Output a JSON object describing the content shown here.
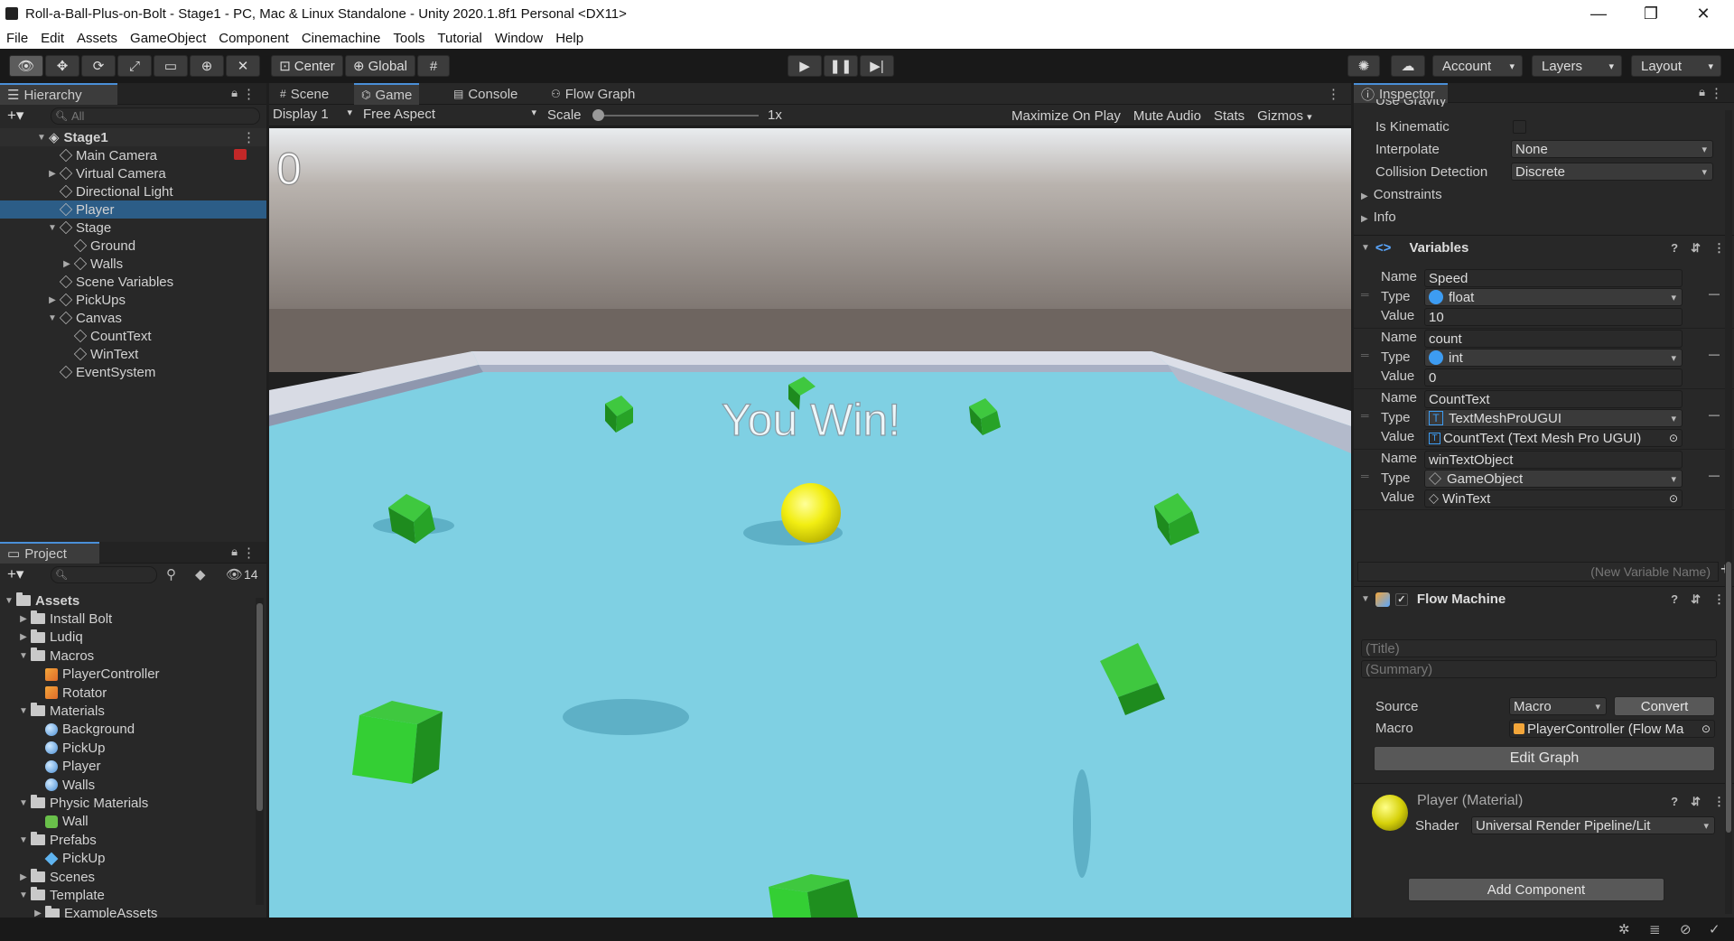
{
  "window": {
    "title": "Roll-a-Ball-Plus-on-Bolt - Stage1 - PC, Mac & Linux Standalone - Unity 2020.1.8f1 Personal <DX11>",
    "minimize": "—",
    "maximize": "❐",
    "close": "✕"
  },
  "menu": [
    "File",
    "Edit",
    "Assets",
    "GameObject",
    "Component",
    "Cinemachine",
    "Tools",
    "Tutorial",
    "Window",
    "Help"
  ],
  "toolbar": {
    "pivot_center": "Center",
    "pivot_global": "Global",
    "account": "Account",
    "layers": "Layers",
    "layout": "Layout"
  },
  "hierarchy": {
    "tab": "Hierarchy",
    "search_placeholder": "All",
    "scene": "Stage1",
    "items": [
      {
        "label": "Main Camera",
        "depth": 1,
        "arrow": ""
      },
      {
        "label": "Virtual Camera",
        "depth": 1,
        "arrow": "▶"
      },
      {
        "label": "Directional Light",
        "depth": 1,
        "arrow": ""
      },
      {
        "label": "Player",
        "depth": 1,
        "arrow": "",
        "selected": true
      },
      {
        "label": "Stage",
        "depth": 1,
        "arrow": "▼"
      },
      {
        "label": "Ground",
        "depth": 2,
        "arrow": ""
      },
      {
        "label": "Walls",
        "depth": 2,
        "arrow": "▶"
      },
      {
        "label": "Scene Variables",
        "depth": 1,
        "arrow": ""
      },
      {
        "label": "PickUps",
        "depth": 1,
        "arrow": "▶"
      },
      {
        "label": "Canvas",
        "depth": 1,
        "arrow": "▼"
      },
      {
        "label": "CountText",
        "depth": 2,
        "arrow": ""
      },
      {
        "label": "WinText",
        "depth": 2,
        "arrow": ""
      },
      {
        "label": "EventSystem",
        "depth": 1,
        "arrow": ""
      }
    ]
  },
  "project": {
    "tab": "Project",
    "hidden_count": "14",
    "items": [
      {
        "label": "Assets",
        "depth": 0,
        "arrow": "▼",
        "icon": "folder",
        "bold": true
      },
      {
        "label": "Install Bolt",
        "depth": 1,
        "arrow": "▶",
        "icon": "folder"
      },
      {
        "label": "Ludiq",
        "depth": 1,
        "arrow": "▶",
        "icon": "folder"
      },
      {
        "label": "Macros",
        "depth": 1,
        "arrow": "▼",
        "icon": "folder"
      },
      {
        "label": "PlayerController",
        "depth": 2,
        "arrow": "",
        "icon": "bolt"
      },
      {
        "label": "Rotator",
        "depth": 2,
        "arrow": "",
        "icon": "bolt"
      },
      {
        "label": "Materials",
        "depth": 1,
        "arrow": "▼",
        "icon": "folder"
      },
      {
        "label": "Background",
        "depth": 2,
        "arrow": "",
        "icon": "sphere"
      },
      {
        "label": "PickUp",
        "depth": 2,
        "arrow": "",
        "icon": "sphere"
      },
      {
        "label": "Player",
        "depth": 2,
        "arrow": "",
        "icon": "sphere"
      },
      {
        "label": "Walls",
        "depth": 2,
        "arrow": "",
        "icon": "sphere"
      },
      {
        "label": "Physic Materials",
        "depth": 1,
        "arrow": "▼",
        "icon": "folder"
      },
      {
        "label": "Wall",
        "depth": 2,
        "arrow": "",
        "icon": "phys"
      },
      {
        "label": "Prefabs",
        "depth": 1,
        "arrow": "▼",
        "icon": "folder"
      },
      {
        "label": "PickUp",
        "depth": 2,
        "arrow": "",
        "icon": "prefab"
      },
      {
        "label": "Scenes",
        "depth": 1,
        "arrow": "▶",
        "icon": "folder"
      },
      {
        "label": "Template",
        "depth": 1,
        "arrow": "▼",
        "icon": "folder"
      },
      {
        "label": "ExampleAssets",
        "depth": 2,
        "arrow": "▶",
        "icon": "folder"
      }
    ]
  },
  "center": {
    "tabs": [
      "Scene",
      "Game",
      "Console",
      "Flow Graph"
    ],
    "display": "Display 1",
    "aspect": "Free Aspect",
    "scale_label": "Scale",
    "scale_value": "1x",
    "maximize": "Maximize On Play",
    "mute": "Mute Audio",
    "stats": "Stats",
    "gizmos": "Gizmos"
  },
  "game": {
    "score": "0",
    "win_text": "You Win!"
  },
  "inspector": {
    "tab": "Inspector",
    "partial_top": "Use Gravity",
    "is_kinematic": "Is Kinematic",
    "interpolate": {
      "label": "Interpolate",
      "value": "None"
    },
    "collision": {
      "label": "Collision Detection",
      "value": "Discrete"
    },
    "constraints": "Constraints",
    "info": "Info",
    "variables_title": "Variables",
    "variables": [
      {
        "name": "Speed",
        "type": "float",
        "value": "10"
      },
      {
        "name": "count",
        "type": "int",
        "value": "0"
      },
      {
        "name": "CountText",
        "type": "TextMeshProUGUI",
        "value": "CountText (Text Mesh Pro UGUI)"
      },
      {
        "name": "winTextObject",
        "type": "GameObject",
        "value": "WinText"
      }
    ],
    "labels": {
      "name": "Name",
      "type": "Type",
      "value": "Value"
    },
    "new_variable": "(New Variable Name)",
    "flow_machine": "Flow Machine",
    "title_placeholder": "(Title)",
    "summary_placeholder": "(Summary)",
    "source_label": "Source",
    "source_value": "Macro",
    "convert": "Convert",
    "macro_label": "Macro",
    "macro_value": "PlayerController (Flow Ma",
    "edit_graph": "Edit Graph",
    "material_title": "Player (Material)",
    "shader_label": "Shader",
    "shader_value": "Universal Render Pipeline/Lit",
    "add_component": "Add Component"
  }
}
